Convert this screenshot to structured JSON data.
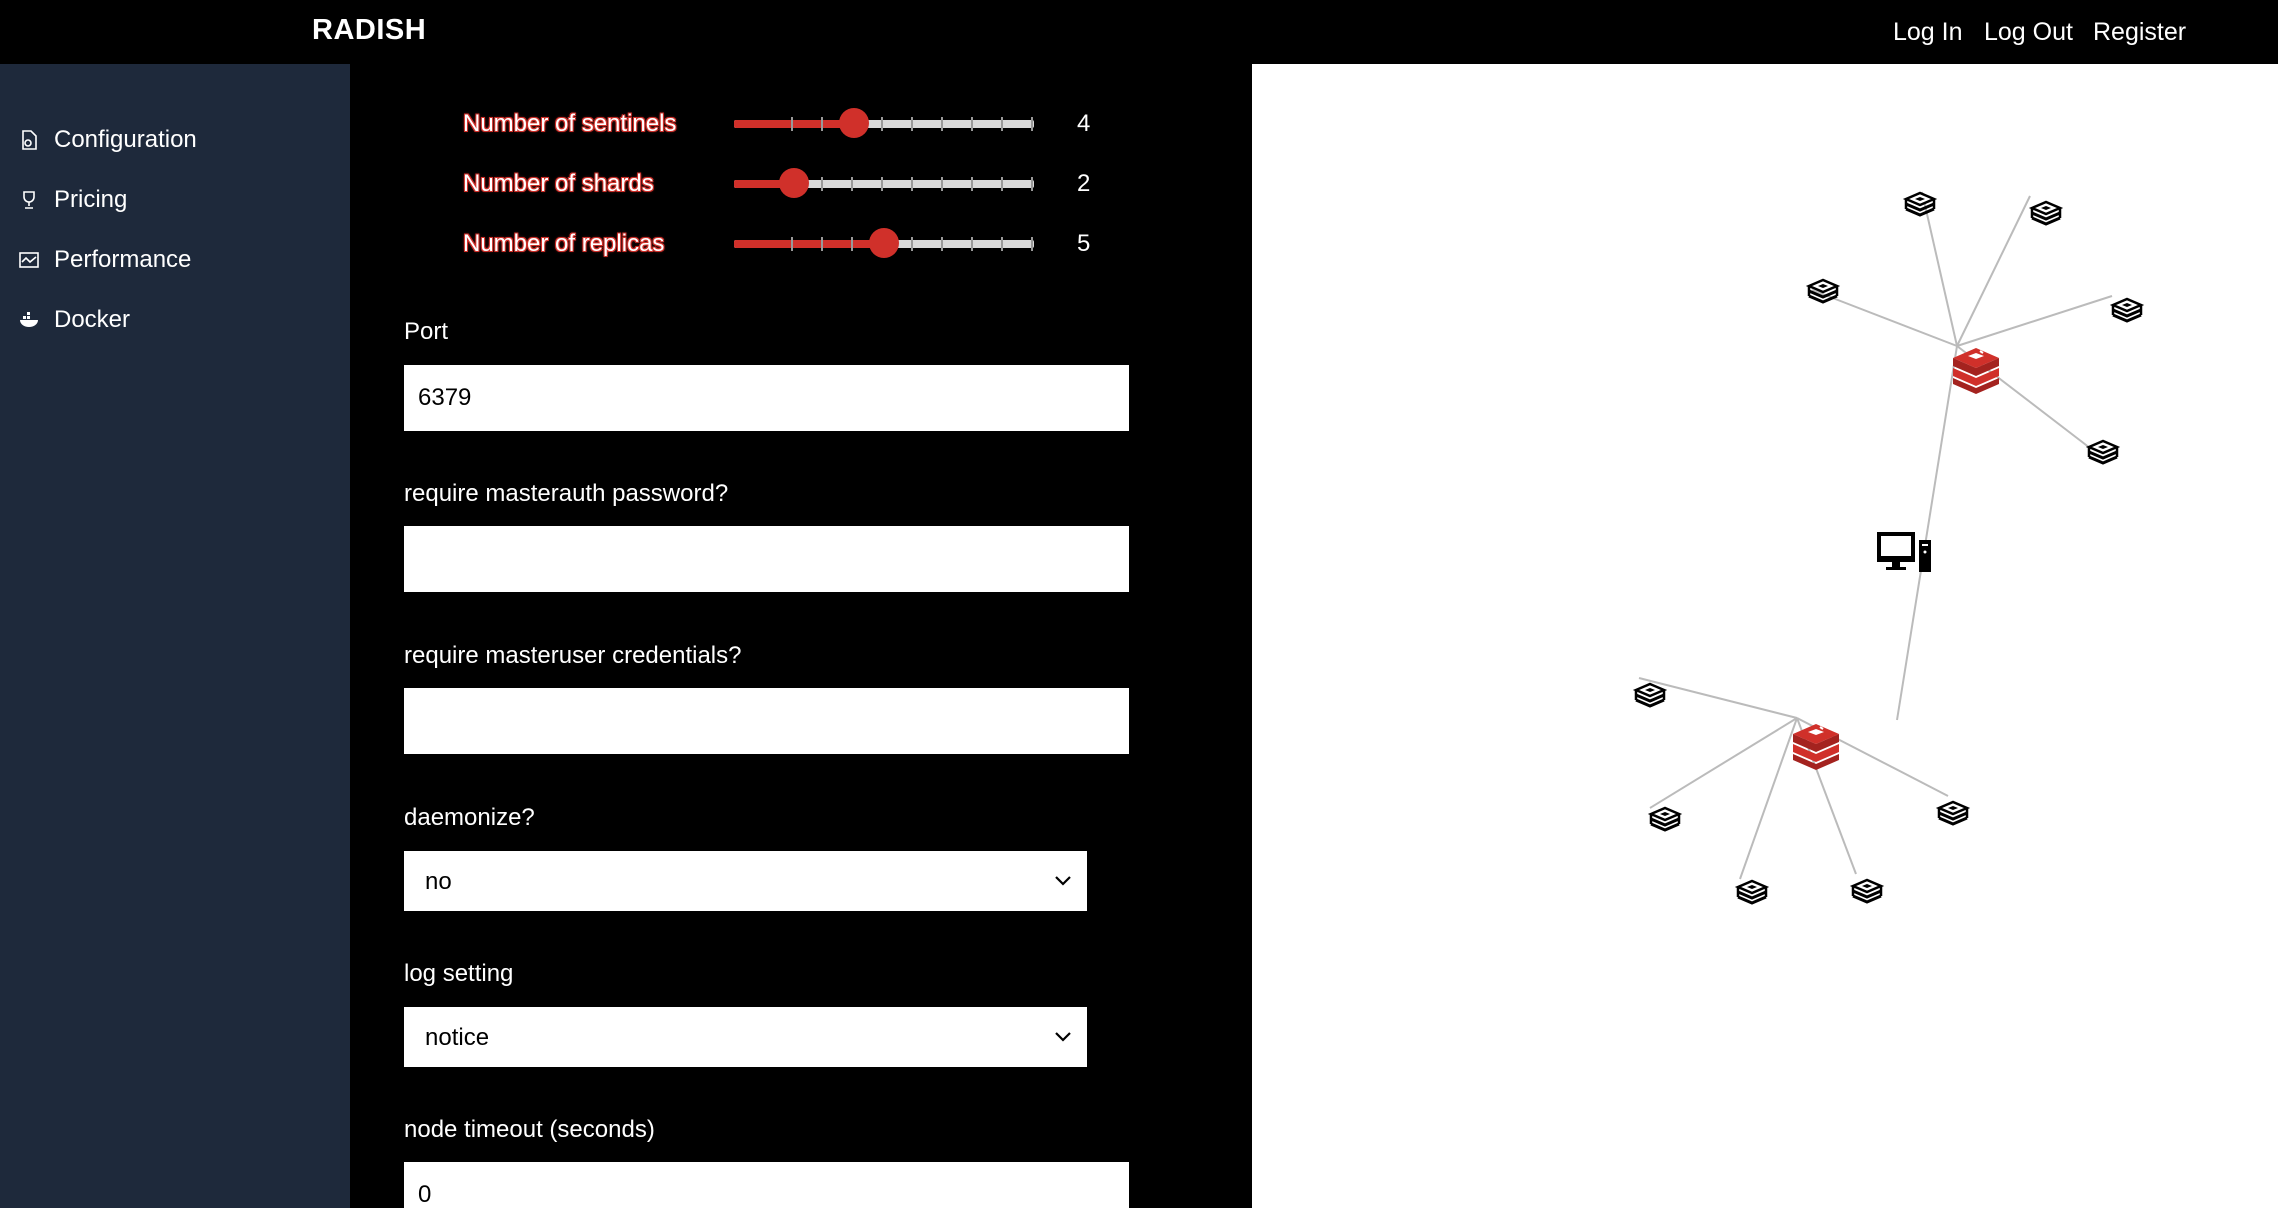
{
  "app": {
    "brand": "RADISH"
  },
  "topnav": {
    "login": "Log In",
    "logout": "Log Out",
    "register": "Register"
  },
  "sidebar": {
    "items": [
      {
        "label": "Configuration",
        "icon": "file-gear-icon"
      },
      {
        "label": "Pricing",
        "icon": "trophy-icon"
      },
      {
        "label": "Performance",
        "icon": "chart-line-icon"
      },
      {
        "label": "Docker",
        "icon": "docker-whale-icon"
      }
    ]
  },
  "sliders": [
    {
      "label": "Number of sentinels",
      "value": "4",
      "min": 0,
      "max": 10
    },
    {
      "label": "Number of shards",
      "value": "2",
      "min": 0,
      "max": 10
    },
    {
      "label": "Number of replicas",
      "value": "5",
      "min": 0,
      "max": 10
    }
  ],
  "fields": {
    "port": {
      "label": "Port",
      "value": "6379"
    },
    "masterauth": {
      "label": "require masterauth password?",
      "value": ""
    },
    "masteruser": {
      "label": "require masteruser credentials?",
      "value": ""
    },
    "daemonize": {
      "label": "daemonize?",
      "value": "no"
    },
    "log_setting": {
      "label": "log setting",
      "value": "notice"
    },
    "node_timeout": {
      "label": "node timeout (seconds)",
      "value": "0"
    }
  },
  "colors": {
    "accent": "#d0302a",
    "sidebar": "#1e293b",
    "background": "#000000",
    "panel": "#ffffff"
  },
  "graph": {
    "client_icon": "desktop-computer-icon",
    "master_icon": "redis-master-icon",
    "replica_icon": "redis-replica-icon"
  }
}
